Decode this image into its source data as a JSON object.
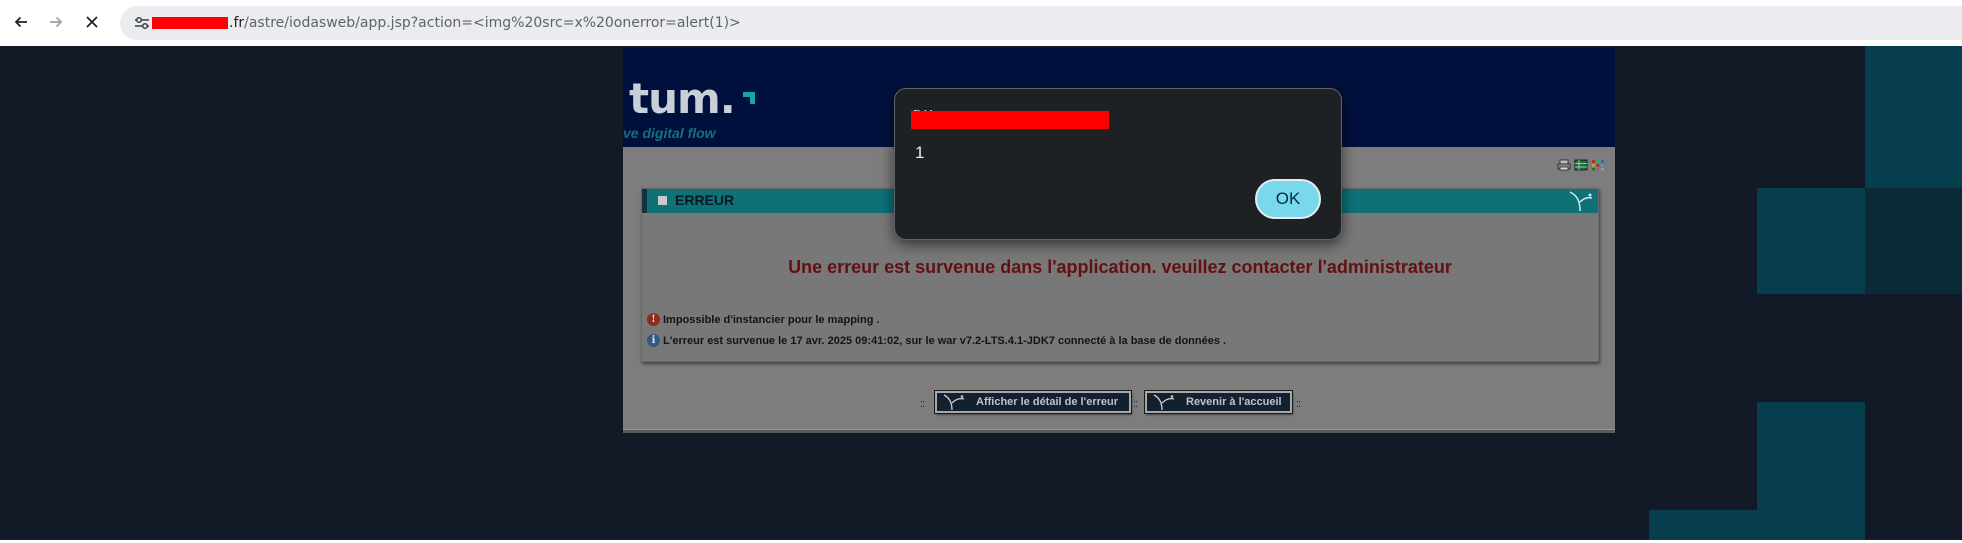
{
  "browser": {
    "url_domain_suffix": ".fr",
    "url_path": "/astre/iodasweb/app.jsp?action=<img%20src=x%20onerror=alert(1)>",
    "back_icon": "arrow-left-icon",
    "forward_icon": "arrow-right-icon",
    "stop_icon": "close-icon",
    "site_info_icon": "tune-icon"
  },
  "app": {
    "brand_partial": "tum.",
    "tagline_partial": "ve digital flow",
    "panel_title": "ERREUR",
    "error_main": "Une erreur est survenue dans l'application. veuillez contacter l'administrateur",
    "messages": [
      {
        "icon": "error-icon",
        "glyph": "!",
        "text": "Impossible d'instancier pour le mapping ."
      },
      {
        "icon": "info-icon",
        "glyph": "i",
        "text": "L'erreur est survenue le 17 avr. 2025 09:41:02, sur le war v7.2-LTS.4.1-JDK7 connecté à la base de données ."
      }
    ],
    "buttons": {
      "detail_label": "Afficher le détail de l'erreur",
      "home_label": "Revenir à l'accueil",
      "separator": "::"
    },
    "toolbar_icons": [
      "print-icon",
      "table-icon",
      "grid-icon"
    ]
  },
  "alert": {
    "origin_partial": "g            y",
    "message": "1",
    "ok_label": "OK"
  },
  "colors": {
    "page_bg": "#131a27",
    "accent_teal": "#0d7176",
    "error_red": "#641010",
    "dialog_bg": "#1e2124",
    "ok_button": "#78d9ec",
    "redaction": "#ff0000"
  }
}
